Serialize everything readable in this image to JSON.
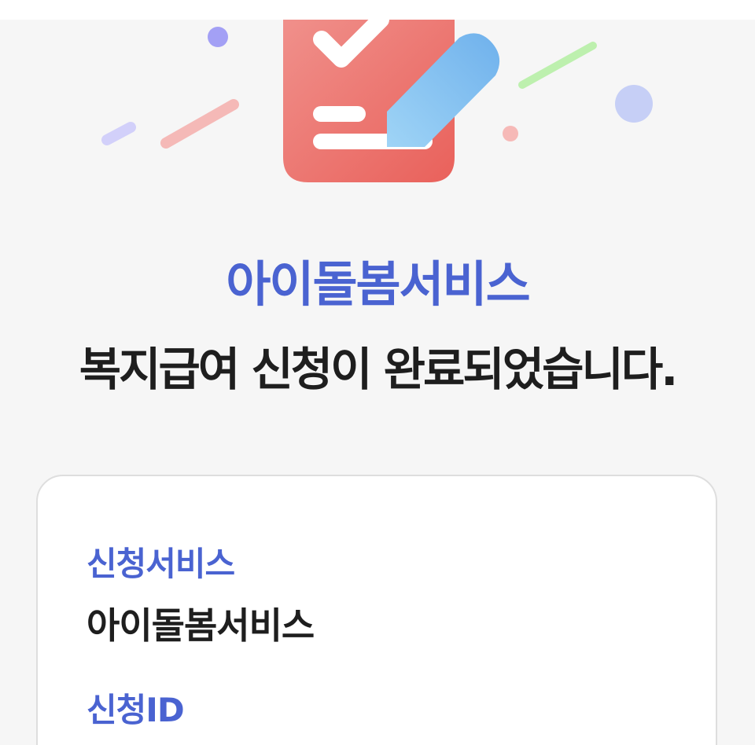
{
  "header": {
    "service_name": "아이돌봄서비스",
    "message": "복지급여 신청이 완료되었습니다."
  },
  "hero": {
    "icon": "clipboard-check-pencil-icon",
    "colors": {
      "clipboard": "#ec6e68",
      "pencil": "#7cc0f0",
      "accent_purple": "#a3a0f5",
      "accent_pink": "#f5b2b0",
      "accent_green": "#b8f0a8",
      "accent_blue": "#c3cdf5"
    }
  },
  "details": {
    "service_label": "신청서비스",
    "service_value": "아이돌봄서비스",
    "id_label": "신청ID"
  },
  "colors": {
    "accent": "#4a63d1",
    "text": "#1e1e1e",
    "background": "#f6f6f6"
  }
}
